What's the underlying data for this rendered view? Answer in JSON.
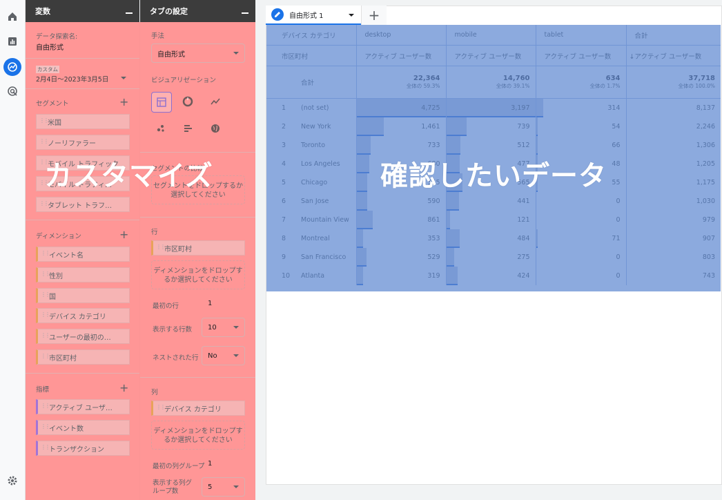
{
  "rail": {
    "icons": [
      "home-icon",
      "reports-icon",
      "explore-icon",
      "advertising-icon",
      "settings-icon"
    ]
  },
  "variables": {
    "title": "変数",
    "exploration_name_label": "データ探索名:",
    "exploration_name": "自由形式",
    "date_tag": "カスタム",
    "date_range": "2月4日～2023年3月5日",
    "segments_label": "セグメント",
    "segments": [
      "米国",
      "ノーリファラー",
      "モバイル トラフィック",
      "モバイル トラフィ…",
      "タブレット トラフ…"
    ],
    "dimensions_label": "ディメンション",
    "dimensions": [
      "イベント名",
      "性別",
      "国",
      "デバイス カテゴリ",
      "ユーザーの最初の…",
      "市区町村"
    ],
    "metrics_label": "指標",
    "metrics": [
      "アクティブ ユーザ…",
      "イベント数",
      "トランザクション"
    ]
  },
  "tab_settings": {
    "title": "タブの設定",
    "technique_label": "手法",
    "technique_value": "自由形式",
    "visualization_label": "ビジュアリゼーション",
    "segment_compare_label": "セグメントの比較",
    "segment_drop": "セグメントをドロップするか選択してください",
    "rows_label": "行",
    "row_chip": "市区町村",
    "dim_drop_rows": "ディメンションをドロップするか選択してください",
    "first_row_label": "最初の行",
    "first_row_value": "1",
    "rows_shown_label": "表示する行数",
    "rows_shown_value": "10",
    "nested_label": "ネストされた行",
    "nested_value": "No",
    "columns_label": "列",
    "col_chip": "デバイス カテゴリ",
    "dim_drop_cols": "ディメンションをドロップするか選択してください",
    "first_col_group_label": "最初の列グループ",
    "first_col_group_value": "1",
    "col_groups_shown_label": "表示する列グループ数",
    "col_groups_shown_value": "5"
  },
  "overlay": {
    "left_text": "カスタマイズ",
    "right_text": "確認したいデータ"
  },
  "tabs": {
    "active_label": "自由形式 1",
    "add_label": "+"
  },
  "table": {
    "dim_header": "デバイス カテゴリ",
    "row_dim_header": "市区町村",
    "total_label": "合計",
    "columns": [
      {
        "name": "desktop",
        "metric": "アクティブ ユーザー数",
        "total": "22,364",
        "pct": "全体の 59.3%"
      },
      {
        "name": "mobile",
        "metric": "アクティブ ユーザー数",
        "total": "14,760",
        "pct": "全体の 39.1%"
      },
      {
        "name": "tablet",
        "metric": "アクティブ ユーザー数",
        "total": "634",
        "pct": "全体の 1.7%"
      },
      {
        "name": "合計",
        "metric": "↓アクティブ ユーザー数",
        "total": "37,718",
        "pct": "全体の 100.0%"
      }
    ],
    "rows": [
      {
        "idx": "1",
        "city": "(not set)",
        "v": [
          "4,725",
          "3,197",
          "314",
          "8,137"
        ],
        "desktop_raw": 4725,
        "mobile_raw": 3197,
        "tablet_raw": 314
      },
      {
        "idx": "2",
        "city": "New York",
        "v": [
          "1,461",
          "739",
          "54",
          "2,246"
        ],
        "desktop_raw": 1461,
        "mobile_raw": 739,
        "tablet_raw": 54
      },
      {
        "idx": "3",
        "city": "Toronto",
        "v": [
          "733",
          "512",
          "66",
          "1,306"
        ],
        "desktop_raw": 733,
        "mobile_raw": 512,
        "tablet_raw": 66
      },
      {
        "idx": "4",
        "city": "Los Angeles",
        "v": [
          "680",
          "477",
          "48",
          "1,205"
        ],
        "desktop_raw": 680,
        "mobile_raw": 477,
        "tablet_raw": 48
      },
      {
        "idx": "5",
        "city": "Chicago",
        "v": [
          "555",
          "565",
          "55",
          "1,175"
        ],
        "desktop_raw": 555,
        "mobile_raw": 565,
        "tablet_raw": 55
      },
      {
        "idx": "6",
        "city": "San Jose",
        "v": [
          "590",
          "441",
          "0",
          "1,030"
        ],
        "desktop_raw": 590,
        "mobile_raw": 441,
        "tablet_raw": 0
      },
      {
        "idx": "7",
        "city": "Mountain View",
        "v": [
          "861",
          "121",
          "0",
          "979"
        ],
        "desktop_raw": 861,
        "mobile_raw": 121,
        "tablet_raw": 0
      },
      {
        "idx": "8",
        "city": "Montreal",
        "v": [
          "353",
          "484",
          "71",
          "907"
        ],
        "desktop_raw": 353,
        "mobile_raw": 484,
        "tablet_raw": 71
      },
      {
        "idx": "9",
        "city": "San Francisco",
        "v": [
          "529",
          "275",
          "0",
          "803"
        ],
        "desktop_raw": 529,
        "mobile_raw": 275,
        "tablet_raw": 0
      },
      {
        "idx": "10",
        "city": "Atlanta",
        "v": [
          "319",
          "424",
          "0",
          "743"
        ],
        "desktop_raw": 319,
        "mobile_raw": 424,
        "tablet_raw": 0
      }
    ]
  },
  "colors": {
    "accent": "#1a73e8",
    "red_overlay": "#ff7878",
    "blue_overlay": "#5f89d1",
    "dimension_chip": "#e8a25a",
    "metric_chip": "#a374d6"
  }
}
